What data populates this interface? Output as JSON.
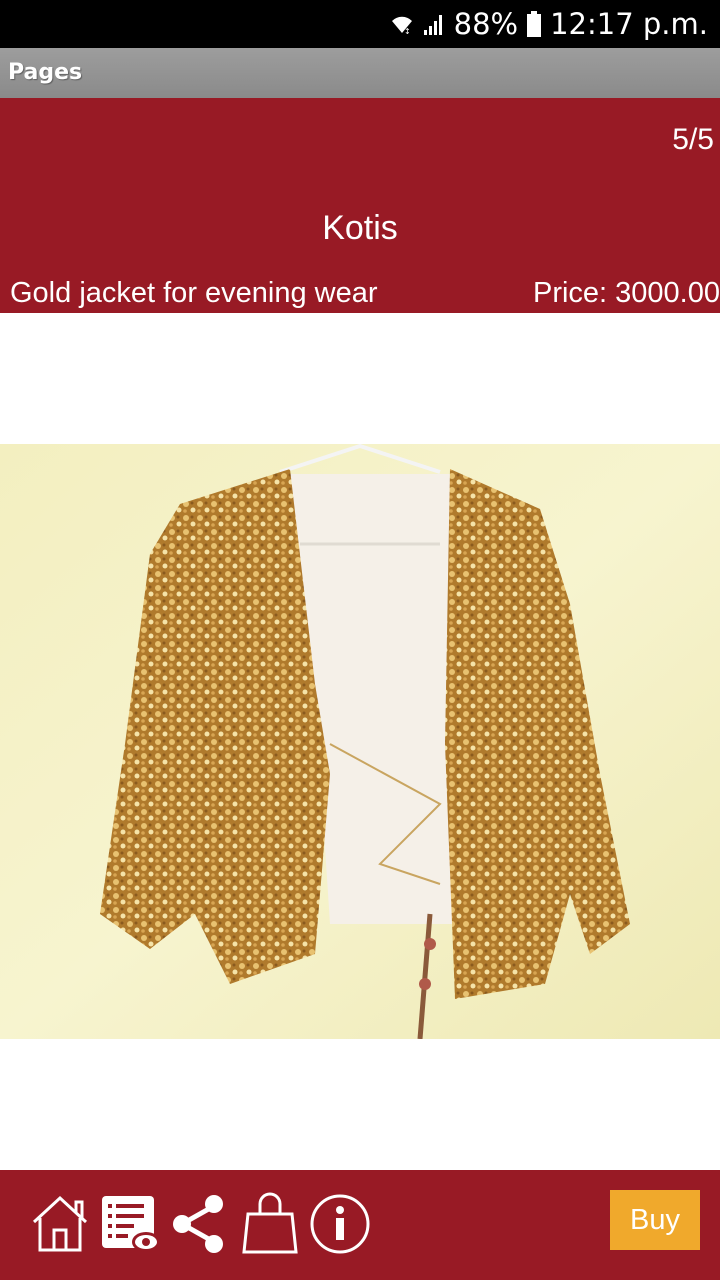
{
  "status_bar": {
    "battery": "88%",
    "time": "12:17 p.m.",
    "icons": [
      "wifi-icon",
      "signal-icon",
      "battery-icon"
    ]
  },
  "action_bar": {
    "title": "Pages"
  },
  "header": {
    "page_counter": "5/5",
    "category": "Kotis",
    "description": "Gold jacket for evening wear",
    "price": "Price: 3000.00"
  },
  "bottom_bar": {
    "icons": [
      "home-icon",
      "catalog-view-icon",
      "share-icon",
      "shopping-bag-icon",
      "info-icon"
    ],
    "buy_label": "Buy"
  },
  "colors": {
    "brand": "#981a25",
    "buy_button": "#f0a92c",
    "action_bar": "#959595"
  }
}
